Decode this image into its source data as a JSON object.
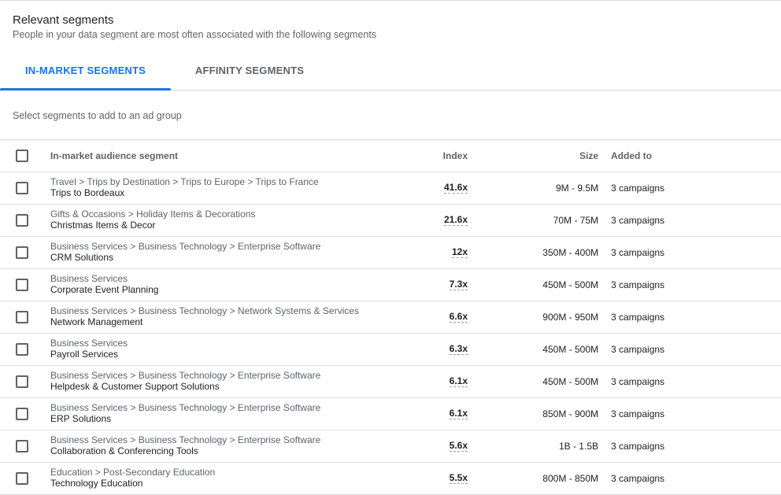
{
  "header": {
    "title": "Relevant segments",
    "subtitle": "People in your data segment are most often associated with the following segments"
  },
  "tabs": [
    {
      "label": "IN-MARKET SEGMENTS",
      "active": true
    },
    {
      "label": "AFFINITY SEGMENTS",
      "active": false
    }
  ],
  "hint": "Select segments to add to an ad group",
  "table": {
    "columns": {
      "segment": "In-market audience segment",
      "index": "Index",
      "size": "Size",
      "added": "Added to"
    },
    "rows": [
      {
        "path": "Travel > Trips by Destination > Trips to Europe > Trips to France",
        "name": "Trips to Bordeaux",
        "index": "41.6x",
        "size": "9M - 9.5M",
        "added": "3 campaigns"
      },
      {
        "path": "Gifts & Occasions > Holiday Items & Decorations",
        "name": "Christmas Items & Decor",
        "index": "21.6x",
        "size": "70M - 75M",
        "added": "3 campaigns"
      },
      {
        "path": "Business Services > Business Technology > Enterprise Software",
        "name": "CRM Solutions",
        "index": "12x",
        "size": "350M - 400M",
        "added": "3 campaigns"
      },
      {
        "path": "Business Services",
        "name": "Corporate Event Planning",
        "index": "7.3x",
        "size": "450M - 500M",
        "added": "3 campaigns"
      },
      {
        "path": "Business Services > Business Technology > Network Systems & Services",
        "name": "Network Management",
        "index": "6.6x",
        "size": "900M - 950M",
        "added": "3 campaigns"
      },
      {
        "path": "Business Services",
        "name": "Payroll Services",
        "index": "6.3x",
        "size": "450M - 500M",
        "added": "3 campaigns"
      },
      {
        "path": "Business Services > Business Technology > Enterprise Software",
        "name": "Helpdesk & Customer Support Solutions",
        "index": "6.1x",
        "size": "450M - 500M",
        "added": "3 campaigns"
      },
      {
        "path": "Business Services > Business Technology > Enterprise Software",
        "name": "ERP Solutions",
        "index": "6.1x",
        "size": "850M - 900M",
        "added": "3 campaigns"
      },
      {
        "path": "Business Services > Business Technology > Enterprise Software",
        "name": "Collaboration & Conferencing Tools",
        "index": "5.6x",
        "size": "1B - 1.5B",
        "added": "3 campaigns"
      },
      {
        "path": "Education > Post-Secondary Education",
        "name": "Technology Education",
        "index": "5.5x",
        "size": "800M - 850M",
        "added": "3 campaigns"
      }
    ]
  },
  "colors": {
    "accent": "#1a73e8",
    "text_primary": "#202124",
    "text_secondary": "#5f6368",
    "divider": "#dadce0"
  }
}
